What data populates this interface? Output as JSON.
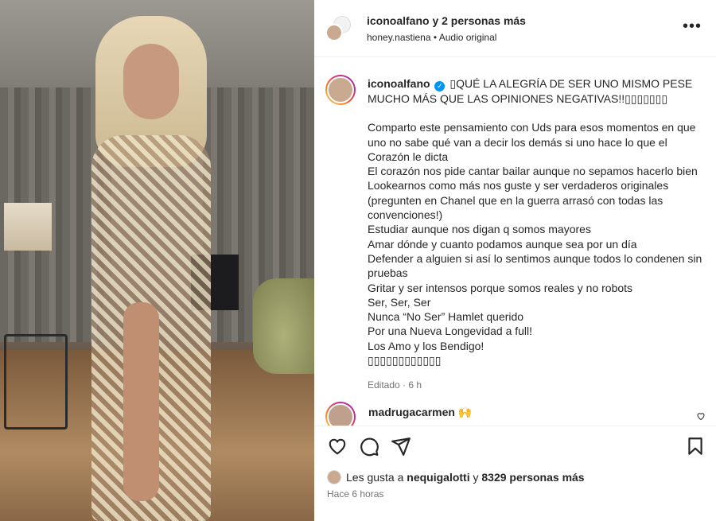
{
  "header": {
    "author": "iconoalfano",
    "coauthors_text": "y 2 personas más",
    "subtitle_user": "honey.nastiena",
    "subtitle_sep": "•",
    "subtitle_audio": "Audio original",
    "more_label": "•••"
  },
  "caption": {
    "username": "iconoalfano",
    "verified_glyph": "✓",
    "lines": [
      "QUÉ LA ALEGRÍA DE SER UNO MISMO PESE MUCHO MÁS QUE LAS OPINIONES NEGATIVAS!!",
      "",
      "Comparto este pensamiento con Uds para esos momentos en que uno no sabe qué van a decir los demás si uno hace lo que el Corazón le dicta",
      "El corazón nos pide cantar bailar aunque no sepamos hacerlo bien",
      "Lookearnos como más nos guste y ser verdaderos originales (pregunten en Chanel que en la guerra arrasó con todas las convenciones!)",
      "Estudiar aunque nos digan q somos mayores",
      "Amar dónde y cuanto podamos aunque sea por un día",
      "Defender a alguien si así lo sentimos aunque todos lo condenen sin pruebas",
      "Gritar y ser intensos porque somos reales y no robots",
      "Ser, Ser, Ser",
      "Nunca “No Ser” Hamlet querido",
      "Por una Nueva Longevidad a full!",
      "Los Amo y los Bendigo!"
    ],
    "emoji_prefix": "▯",
    "emoji_suffix": "▯▯▯▯▯▯▯",
    "emoji_final": "▯▯▯▯▯▯▯▯▯▯▯▯",
    "edited": "Editado · 6 h"
  },
  "comment": {
    "username": "madrugacarmen",
    "emoji": "🙌"
  },
  "footer": {
    "likes_prefix": "Les gusta a",
    "likes_user": "nequigalotti",
    "likes_conj": "y",
    "likes_rest": "8329 personas más",
    "time": "Hace 6 horas"
  },
  "icons": [
    "heart-icon",
    "comment-icon",
    "share-icon",
    "save-icon",
    "more-icon"
  ]
}
